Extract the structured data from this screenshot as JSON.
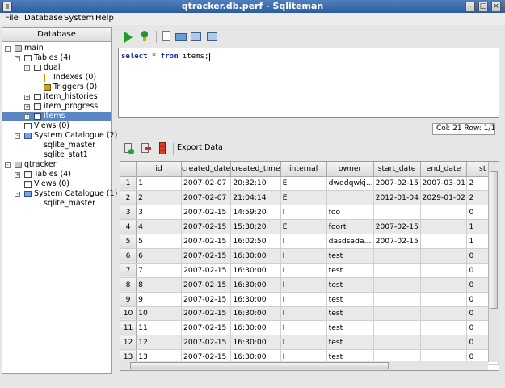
{
  "window": {
    "title": "qtracker.db.perf - Sqliteman"
  },
  "menu": [
    "File",
    "Database",
    "System",
    "Help"
  ],
  "left_panel": {
    "header": "Database",
    "tree": [
      {
        "label": "main",
        "icon": "database-icon",
        "expander": "-"
      },
      {
        "label": "Tables (4)",
        "icon": "table-icon",
        "expander": "-"
      },
      {
        "label": "dual",
        "icon": "table-icon",
        "expander": "-"
      },
      {
        "label": "Indexes (0)",
        "icon": "index-icon",
        "expander": ""
      },
      {
        "label": "Triggers (0)",
        "icon": "trigger-icon",
        "expander": ""
      },
      {
        "label": "item_histories",
        "icon": "table-icon",
        "expander": "+"
      },
      {
        "label": "item_progress",
        "icon": "table-icon",
        "expander": "+"
      },
      {
        "label": "items",
        "icon": "table-icon",
        "expander": "+"
      },
      {
        "label": "Views (0)",
        "icon": "view-icon",
        "expander": ""
      },
      {
        "label": "System Catalogue (2)",
        "icon": "catalogue-icon",
        "expander": "-"
      },
      {
        "label": "sqlite_master",
        "icon": "",
        "expander": ""
      },
      {
        "label": "sqlite_stat1",
        "icon": "",
        "expander": ""
      },
      {
        "label": "qtracker",
        "icon": "database-icon",
        "expander": "-"
      },
      {
        "label": "Tables (4)",
        "icon": "table-icon",
        "expander": "+"
      },
      {
        "label": "Views (0)",
        "icon": "view-icon",
        "expander": ""
      },
      {
        "label": "System Catalogue (1)",
        "icon": "catalogue-icon",
        "expander": "-"
      },
      {
        "label": "sqlite_master",
        "icon": "",
        "expander": ""
      }
    ],
    "selected_index": 7
  },
  "editor": {
    "sql_kw1": "select",
    "sql_mid": " * ",
    "sql_kw2": "from",
    "sql_rest": " items;"
  },
  "status": {
    "position": "Col: 21 Row: 1/1"
  },
  "data_toolbar": {
    "export_label": "Export Data"
  },
  "grid": {
    "columns": [
      "id",
      "created_date",
      "created_time",
      "internal",
      "owner",
      "start_date",
      "end_date",
      "st"
    ],
    "rows": [
      [
        "1",
        "2007-02-07",
        "20:32:10",
        "E",
        "dwqdqwkj...",
        "2007-02-15",
        "2007-03-01",
        "2"
      ],
      [
        "2",
        "2007-02-07",
        "21:04:14",
        "E",
        "",
        "2012-01-04",
        "2029-01-02",
        "2"
      ],
      [
        "3",
        "2007-02-15",
        "14:59:20",
        "I",
        "foo",
        "",
        "",
        "0"
      ],
      [
        "4",
        "2007-02-15",
        "15:30:20",
        "E",
        "foort",
        "2007-02-15",
        "",
        "1"
      ],
      [
        "5",
        "2007-02-15",
        "16:02:50",
        "I",
        "dasdsada...",
        "2007-02-15",
        "",
        "1"
      ],
      [
        "6",
        "2007-02-15",
        "16:30:00",
        "I",
        "test",
        "",
        "",
        "0"
      ],
      [
        "7",
        "2007-02-15",
        "16:30:00",
        "I",
        "test",
        "",
        "",
        "0"
      ],
      [
        "8",
        "2007-02-15",
        "16:30:00",
        "I",
        "test",
        "",
        "",
        "0"
      ],
      [
        "9",
        "2007-02-15",
        "16:30:00",
        "I",
        "test",
        "",
        "",
        "0"
      ],
      [
        "10",
        "2007-02-15",
        "16:30:00",
        "I",
        "test",
        "",
        "",
        "0"
      ],
      [
        "11",
        "2007-02-15",
        "16:30:00",
        "I",
        "test",
        "",
        "",
        "0"
      ],
      [
        "12",
        "2007-02-15",
        "16:30:00",
        "I",
        "test",
        "",
        "",
        "0"
      ],
      [
        "13",
        "2007-02-15",
        "16:30:00",
        "I",
        "test",
        "",
        "",
        "0"
      ]
    ],
    "row_headers": [
      "1",
      "2",
      "3",
      "4",
      "5",
      "6",
      "7",
      "8",
      "9",
      "10",
      "11",
      "12",
      "13"
    ]
  }
}
